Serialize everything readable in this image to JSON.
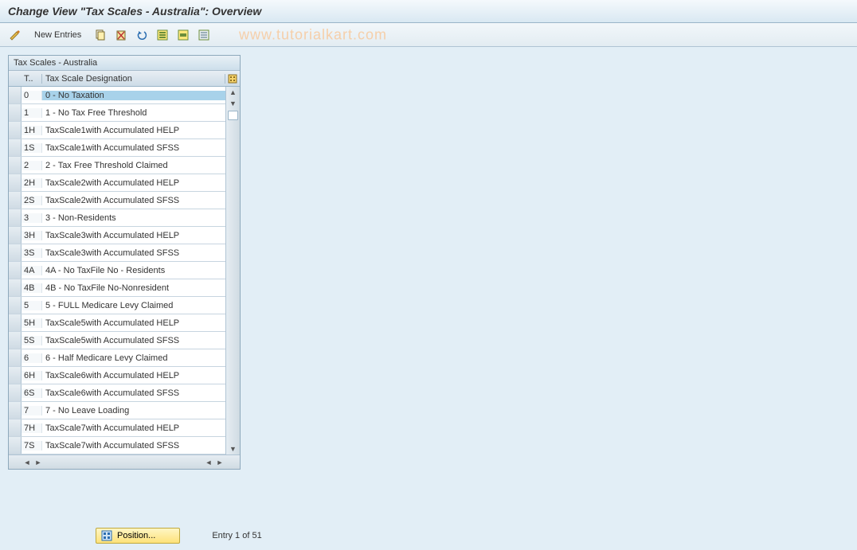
{
  "title": "Change View \"Tax Scales - Australia\": Overview",
  "toolbar": {
    "new_entries": "New Entries"
  },
  "watermark": "www.tutorialkart.com",
  "panel": {
    "title": "Tax Scales - Australia",
    "columns": {
      "code": "T..",
      "designation": "Tax Scale Designation"
    }
  },
  "rows": [
    {
      "code": "0",
      "designation": "0 - No Taxation",
      "selected": true
    },
    {
      "code": "1",
      "designation": "1 - No Tax Free Threshold"
    },
    {
      "code": "1H",
      "designation": "TaxScale1with Accumulated HELP"
    },
    {
      "code": "1S",
      "designation": "TaxScale1with Accumulated SFSS"
    },
    {
      "code": "2",
      "designation": "2 - Tax Free Threshold Claimed"
    },
    {
      "code": "2H",
      "designation": "TaxScale2with Accumulated HELP"
    },
    {
      "code": "2S",
      "designation": "TaxScale2with Accumulated SFSS"
    },
    {
      "code": "3",
      "designation": "3 - Non-Residents"
    },
    {
      "code": "3H",
      "designation": "TaxScale3with Accumulated HELP"
    },
    {
      "code": "3S",
      "designation": "TaxScale3with Accumulated SFSS"
    },
    {
      "code": "4A",
      "designation": "4A - No TaxFile No - Residents"
    },
    {
      "code": "4B",
      "designation": "4B - No TaxFile No-Nonresident"
    },
    {
      "code": "5",
      "designation": "5 - FULL Medicare Levy Claimed"
    },
    {
      "code": "5H",
      "designation": "TaxScale5with Accumulated HELP"
    },
    {
      "code": "5S",
      "designation": "TaxScale5with Accumulated SFSS"
    },
    {
      "code": "6",
      "designation": "6 - Half Medicare Levy Claimed"
    },
    {
      "code": "6H",
      "designation": "TaxScale6with Accumulated HELP"
    },
    {
      "code": "6S",
      "designation": "TaxScale6with Accumulated SFSS"
    },
    {
      "code": "7",
      "designation": "7 - No Leave Loading"
    },
    {
      "code": "7H",
      "designation": "TaxScale7with Accumulated HELP"
    },
    {
      "code": "7S",
      "designation": "TaxScale7with Accumulated SFSS"
    }
  ],
  "footer": {
    "position_label": "Position...",
    "entry_text": "Entry 1 of 51"
  }
}
